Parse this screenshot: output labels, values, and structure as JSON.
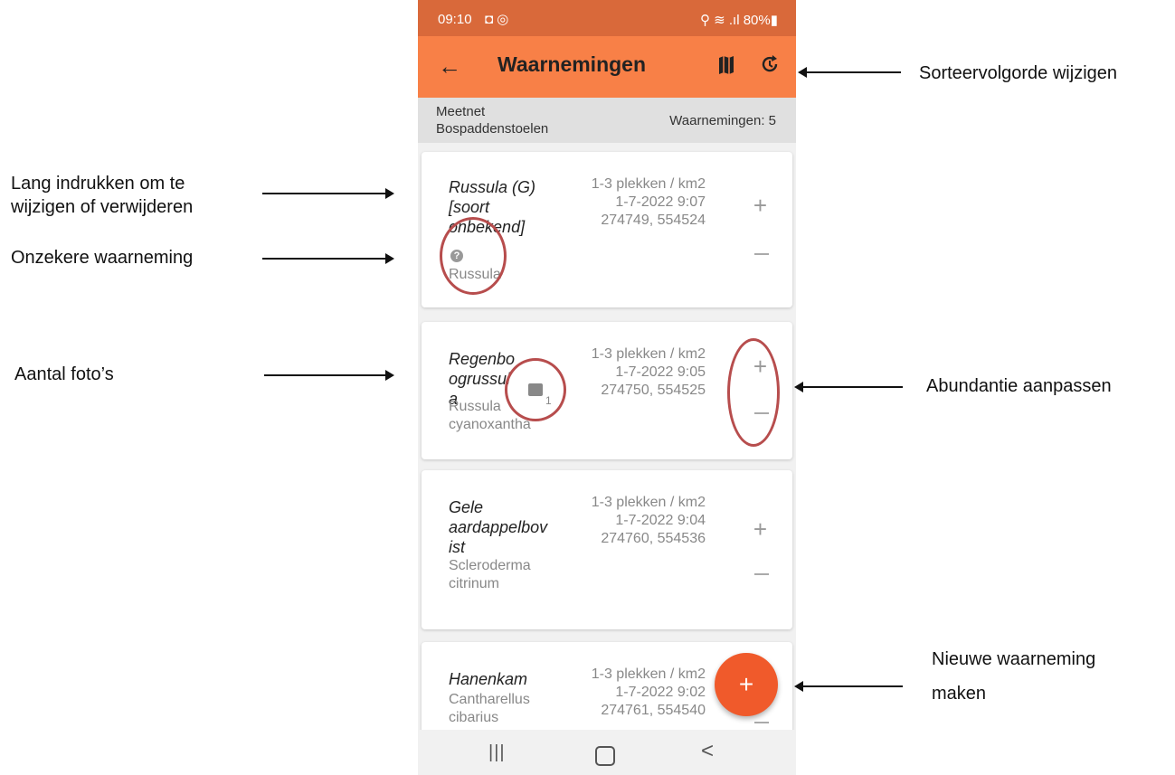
{
  "status": {
    "time": "09:10",
    "left_icons": "◘ ◎",
    "right": "⚲ ≋ .ıl 80%▮"
  },
  "appbar": {
    "back": "←",
    "title": "Waarnemingen"
  },
  "subheader": {
    "project": "Meetnet Bospaddenstoelen",
    "count": "Waarnemingen: 5"
  },
  "cards": [
    {
      "name": "Russula (G) [soort onbekend]",
      "latin": "Russula",
      "abundance": "1-3 plekken / km2",
      "datetime": "1-7-2022 9:07",
      "coords": "274749, 554524",
      "uncertain_icon": "?"
    },
    {
      "name": "Regenboogrussula",
      "latin": "Russula cyanoxantha",
      "abundance": "1-3 plekken / km2",
      "datetime": "1-7-2022 9:05",
      "coords": "274750, 554525",
      "photo_count": "1"
    },
    {
      "name": "Gele aardappelbovist",
      "latin": "Scleroderma citrinum",
      "abundance": "1-3 plekken / km2",
      "datetime": "1-7-2022 9:04",
      "coords": "274760, 554536"
    },
    {
      "name": "Hanenkam",
      "latin": "Cantharellus cibarius",
      "abundance": "1-3 plekken / km2",
      "datetime": "1-7-2022 9:02",
      "coords": "274761, 554540"
    }
  ],
  "fab": "+",
  "nav": {
    "recent": "|||",
    "back": "<"
  },
  "annotations": {
    "sort": "Sorteervolgorde wijzigen",
    "longpress": "Lang indrukken om te wijzigen of verwijderen",
    "uncertain": "Onzekere waarneming",
    "photos": "Aantal foto’s",
    "abundance": "Abundantie aanpassen",
    "new": "Nieuwe waarneming maken"
  },
  "colors": {
    "appbar": "#f88047",
    "statusbar": "#d9693a",
    "fab": "#f05a2b",
    "highlight": "#b74d4d"
  }
}
